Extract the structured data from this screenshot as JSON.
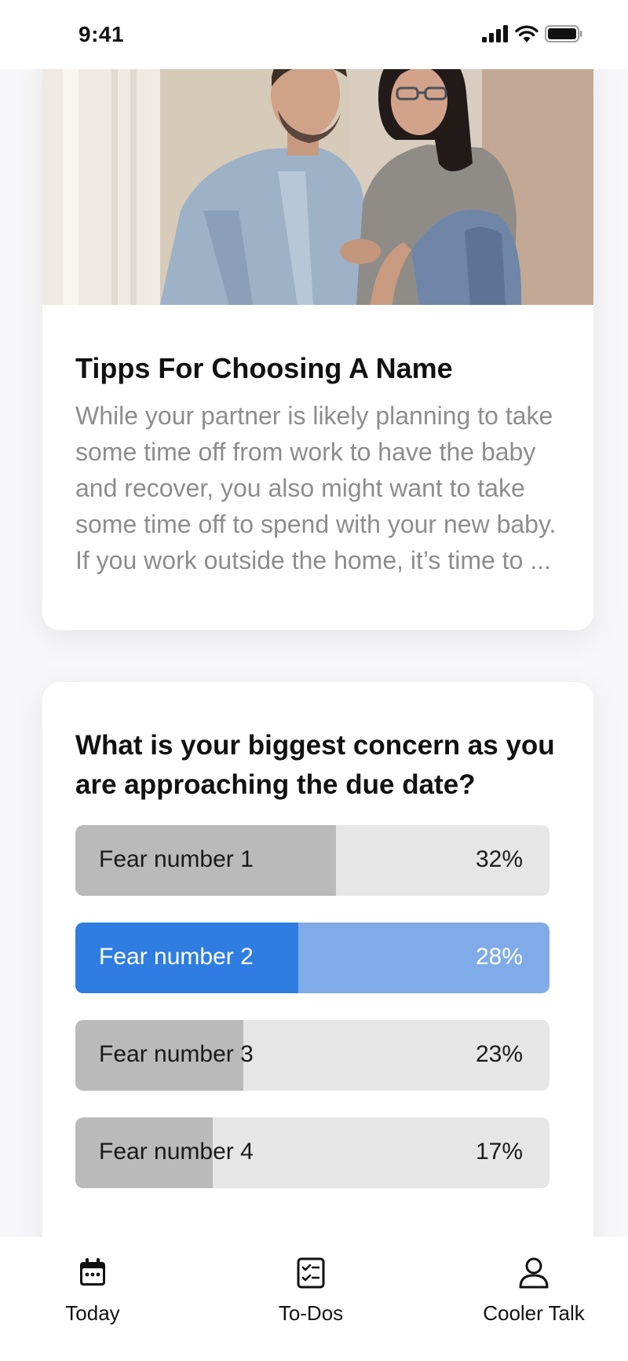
{
  "status_bar": {
    "time": "9:41"
  },
  "article": {
    "image": "couple-photo",
    "title": "Tipps For Choosing A Name",
    "body": "While your partner is likely planning to take some time off from work to have the baby and recover, you also might want to take some time off to spend with your new baby. If you work outside the home, it’s time to ..."
  },
  "poll": {
    "question": "What is your biggest concern as you are approaching the due date?",
    "options": [
      {
        "label": "Fear number 1",
        "percent_text": "32%",
        "fill": 0.55,
        "selected": false
      },
      {
        "label": "Fear number 2",
        "percent_text": "28%",
        "fill": 0.47,
        "selected": true
      },
      {
        "label": "Fear number 3",
        "percent_text": "23%",
        "fill": 0.355,
        "selected": false
      },
      {
        "label": "Fear number 4",
        "percent_text": "17%",
        "fill": 0.29,
        "selected": false
      }
    ]
  },
  "tab_bar": {
    "tabs": [
      {
        "label": "Today",
        "icon": "calendar-icon"
      },
      {
        "label": "To-Dos",
        "icon": "checklist-icon"
      },
      {
        "label": "Cooler Talk",
        "icon": "person-icon"
      }
    ]
  },
  "colors": {
    "accent": "#2f7de1",
    "accent_light": "#7fabe8",
    "bar_fill": "#bababa",
    "bar_track": "#e6e6e6"
  }
}
